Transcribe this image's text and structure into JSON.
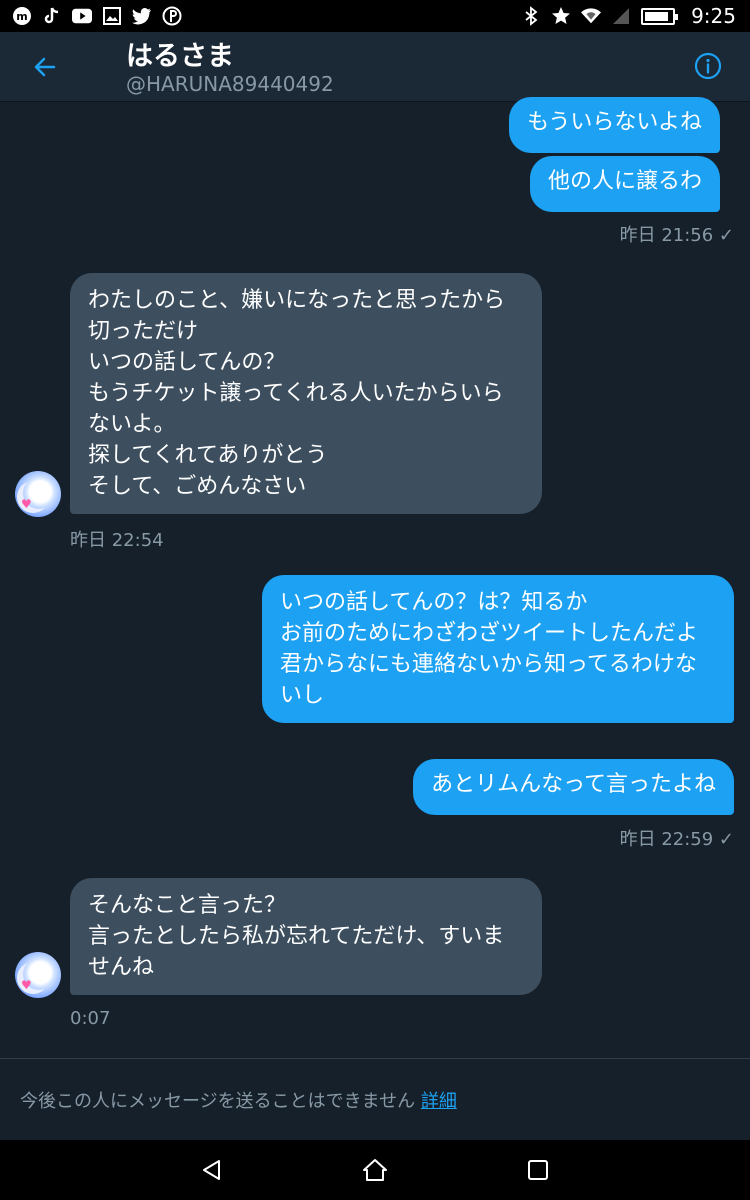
{
  "status_bar": {
    "time": "9:25",
    "left_icons": [
      "mercari-icon",
      "tiktok-icon",
      "youtube-icon",
      "gallery-icon",
      "twitter-icon",
      "pinterest-icon"
    ],
    "right_icons": [
      "bluetooth-icon",
      "star-icon",
      "wifi-icon",
      "signal-icon",
      "battery-icon"
    ],
    "battery_level": 0.9
  },
  "header": {
    "title": "はるさま",
    "handle": "@HARUNA89440492"
  },
  "messages": [
    {
      "side": "out",
      "text": "もういらないよね"
    },
    {
      "side": "out",
      "text": "他の人に譲るわ"
    },
    {
      "side": "in",
      "text": "わたしのこと、嫌いになったと思ったから切っただけ\nいつの話してんの？\nもうチケット譲ってくれる人いたからいらないよ。\n探してくれてありがとう\nそして、ごめんなさい"
    },
    {
      "side": "out",
      "text": "いつの話してんの？は？知るか\nお前のためにわざわざツイートしたんだよ\n君からなにも連絡ないから知ってるわけないし"
    },
    {
      "side": "out",
      "text": "あとリムんなって言ったよね"
    },
    {
      "side": "in",
      "text": "そんなこと言った？\n言ったとしたら私が忘れてただけ、すいませんね"
    }
  ],
  "timestamps": [
    "昨日 21:56 ✓",
    "昨日 22:54",
    "昨日 22:59 ✓",
    "0:07"
  ],
  "footer": {
    "notice": "今後この人にメッセージを送ることはできません",
    "link": "詳細"
  },
  "colors": {
    "background": "#15202b",
    "outgoing_bubble": "#1da1f2",
    "incoming_bubble": "#3d4f5f",
    "accent": "#1da1f2",
    "muted_text": "#8899a6"
  }
}
